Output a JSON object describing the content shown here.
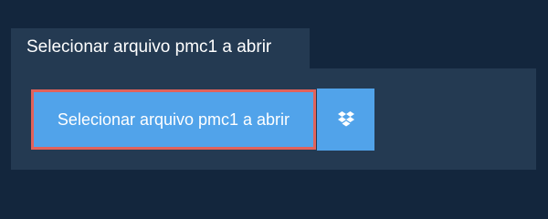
{
  "panel": {
    "title": "Selecionar arquivo pmc1 a abrir"
  },
  "buttons": {
    "select_file_label": "Selecionar arquivo pmc1 a abrir",
    "dropbox_icon": "dropbox-icon"
  },
  "colors": {
    "page_background": "#13263d",
    "panel_background": "#243a52",
    "button_background": "#51a3ea",
    "focus_outline": "#e1625b",
    "text": "#ffffff"
  }
}
